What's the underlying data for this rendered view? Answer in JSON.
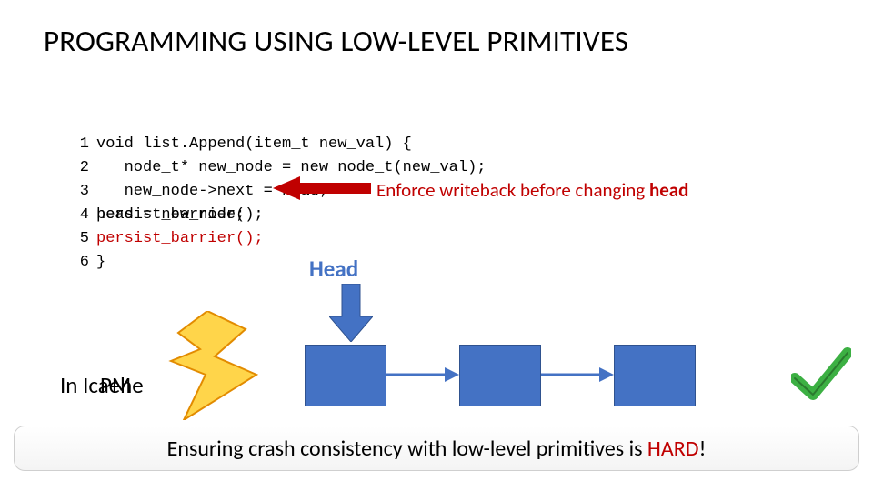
{
  "title": "PROGRAMMING USING LOW-LEVEL PRIMITIVES",
  "code": {
    "ln1": "1",
    "ln2": "2",
    "ln3": "3",
    "ln4": "4",
    "ln5": "5",
    "ln6": "6",
    "l1": "void list.Append(item_t new_val) {",
    "l2": "   node_t* new_node = new node_t(new_val);",
    "l3": "   new_node->next = head;",
    "l4_under": "head = new_node;",
    "l4_over": "persist_barrier();",
    "l5": "persist_barrier();",
    "l6": "}"
  },
  "enforce": {
    "pre": "Enforce writeback before changing ",
    "bold": "head"
  },
  "head_label": "Head",
  "incache": {
    "a": "In ",
    "b": "Icaehe",
    "c": "PM"
  },
  "footer": {
    "pre": "Ensuring crash consistency with low-level primitives is ",
    "hard": "HARD",
    "post": "!"
  },
  "colors": {
    "accent_blue": "#4472c4",
    "accent_red": "#c00000",
    "check_green": "#3cb043"
  }
}
